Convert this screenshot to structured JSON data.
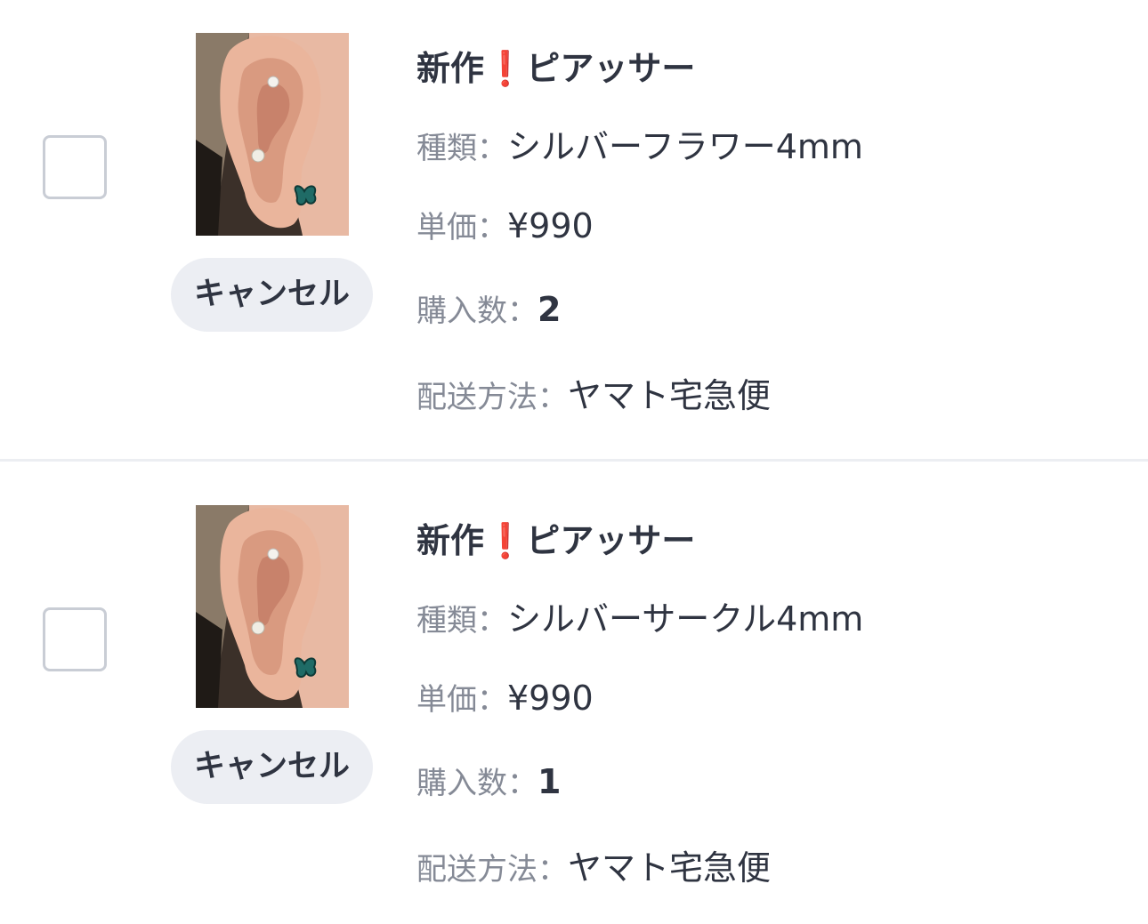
{
  "items": [
    {
      "title": "新作❗️ピアッサー",
      "kind_label": "種類：",
      "kind_value": "シルバーフラワー4mm",
      "price_label": "単価：",
      "price_value": "¥990",
      "qty_label": "購入数：",
      "qty_value": "2",
      "ship_label": "配送方法：",
      "ship_value": "ヤマト宅急便",
      "cancel_label": "キャンセル"
    },
    {
      "title": "新作❗️ピアッサー",
      "kind_label": "種類：",
      "kind_value": "シルバーサークル4mm",
      "price_label": "単価：",
      "price_value": "¥990",
      "qty_label": "購入数：",
      "qty_value": "1",
      "ship_label": "配送方法：",
      "ship_value": "ヤマト宅急便",
      "cancel_label": "キャンセル"
    }
  ]
}
